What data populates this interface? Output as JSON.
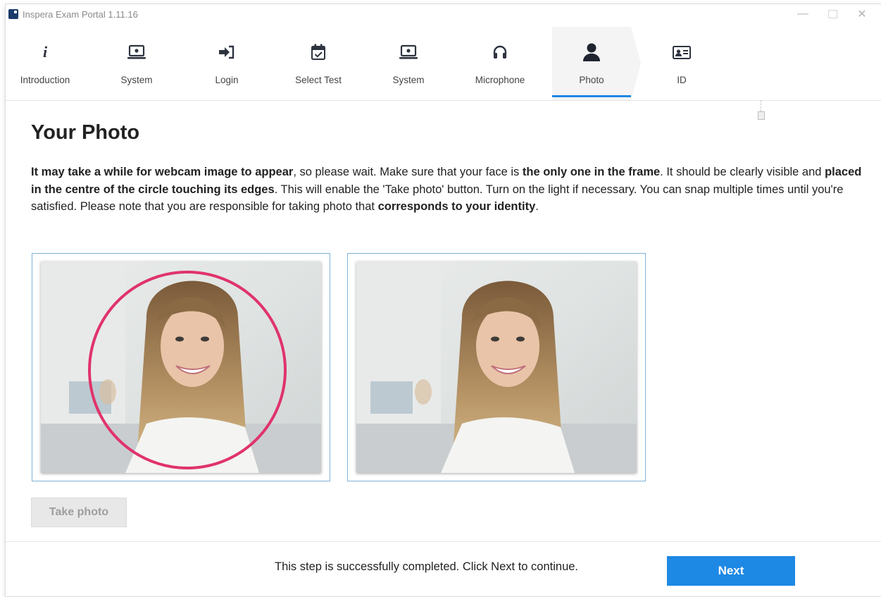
{
  "window": {
    "title": "Inspera Exam Portal 1.11.16",
    "controls": {
      "minimize": "—",
      "close": "✕"
    }
  },
  "steps": [
    {
      "label": "Introduction",
      "icon": "info-icon",
      "active": false
    },
    {
      "label": "System",
      "icon": "laptop-icon",
      "active": false
    },
    {
      "label": "Login",
      "icon": "login-arrow-icon",
      "active": false
    },
    {
      "label": "Select Test",
      "icon": "calendar-check-icon",
      "active": false
    },
    {
      "label": "System",
      "icon": "laptop-icon",
      "active": false
    },
    {
      "label": "Microphone",
      "icon": "headphones-icon",
      "active": false
    },
    {
      "label": "Photo",
      "icon": "person-icon",
      "active": true
    },
    {
      "label": "ID",
      "icon": "id-card-icon",
      "active": false
    }
  ],
  "main": {
    "heading": "Your Photo",
    "instructions": [
      {
        "text": "It may take a while for webcam image to appear",
        "bold": true
      },
      {
        "text": ", so please wait. Make sure that your face is ",
        "bold": false
      },
      {
        "text": "the only one in the frame",
        "bold": true
      },
      {
        "text": ". It should be clearly visible and ",
        "bold": false
      },
      {
        "text": "placed in the centre of the circle touching its edges",
        "bold": true
      },
      {
        "text": ". This will enable the 'Take photo' button. Turn on the light if necessary. You can snap multiple times until you're satisfied. Please note that you are responsible for taking photo that ",
        "bold": false
      },
      {
        "text": "corresponds to your identity",
        "bold": true
      },
      {
        "text": ".",
        "bold": false
      }
    ],
    "take_photo_label": "Take photo"
  },
  "footer": {
    "status": "This step is successfully completed. Click Next to continue.",
    "next_label": "Next"
  },
  "colors": {
    "accent": "#1e88e5",
    "guide_circle": "#e0336b",
    "frame_border": "#7fb2d8",
    "icon": "#2d3440"
  }
}
